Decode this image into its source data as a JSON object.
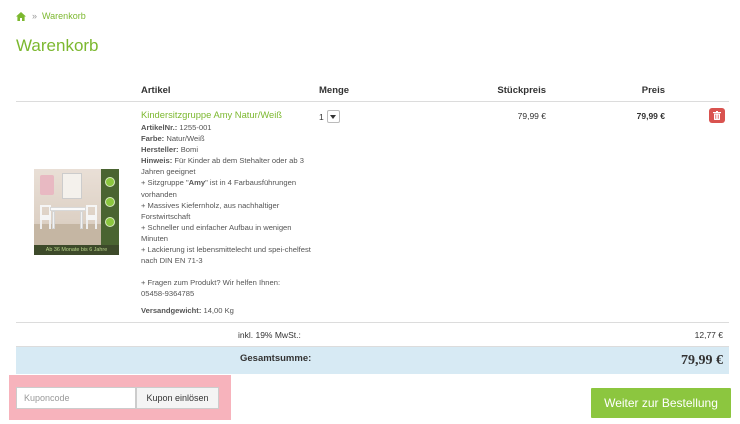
{
  "breadcrumb": {
    "home_icon": "home-icon",
    "separator": "»",
    "current": "Warenkorb"
  },
  "page": {
    "title": "Warenkorb"
  },
  "table": {
    "headers": {
      "article": "Artikel",
      "quantity": "Menge",
      "unit_price": "Stückpreis",
      "price": "Preis"
    }
  },
  "item": {
    "name": "Kindersitzgruppe Amy Natur/Weiß",
    "sku_label": "ArtikelNr.:",
    "sku": "1255-001",
    "color_label": "Farbe:",
    "color": "Natur/Weiß",
    "maker_label": "Hersteller:",
    "maker": "Bomi",
    "hint_label": "Hinweis:",
    "hint": "Für Kinder ab dem Stehalter oder ab 3 Jahren geeignet",
    "feature1_pre": "+ Sitzgruppe \"",
    "feature1_bold": "Amy",
    "feature1_post": "\" ist in 4 Farbausführungen vorhanden",
    "feature2": "+ Massives Kiefernholz, aus nachhaltiger Forstwirtschaft",
    "feature3": "+ Schneller und einfacher Aufbau in wenigen Minuten",
    "feature4": "+ Lackierung ist lebensmittelecht und spei-chelfest nach DIN EN 71-3",
    "question": "+ Fragen zum Produkt? Wir helfen Ihnen:",
    "phone": "05458-9364785",
    "weight_label": "Versandgewicht:",
    "weight": "14,00 Kg",
    "image_caption": "Ab 36 Monate bis 6 Jahre",
    "quantity": "1",
    "unit_price": "79,99 €",
    "line_price": "79,99 €",
    "delete_icon": "trash-icon"
  },
  "summary": {
    "tax_label": "inkl. 19% MwSt.:",
    "tax_value": "12,77 €",
    "total_label": "Gesamtsumme:",
    "total_value": "79,99 €"
  },
  "coupon": {
    "placeholder": "Kuponcode",
    "button": "Kupon einlösen"
  },
  "checkout": {
    "button": "Weiter zur Bestellung"
  },
  "colors": {
    "accent": "#7cb82f",
    "button_green": "#8cc63f",
    "delete_red": "#d9534f",
    "total_bg": "#d7eaf4",
    "coupon_highlight": "#f7b3bc"
  }
}
